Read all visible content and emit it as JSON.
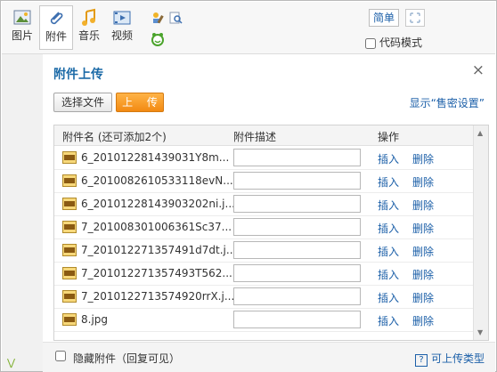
{
  "toolbar": {
    "buttons": [
      {
        "label": "图片",
        "icon": "image-icon"
      },
      {
        "label": "附件",
        "icon": "paperclip-icon"
      },
      {
        "label": "音乐",
        "icon": "music-icon"
      },
      {
        "label": "视频",
        "icon": "video-icon"
      }
    ],
    "simplified_label": "简单",
    "code_mode_label": "代码模式"
  },
  "panel": {
    "title": "附件上传",
    "close": "×",
    "choose_file": "选择文件",
    "upload": "上 传",
    "show_secret": "显示“售密设置”",
    "table_headers": {
      "name": "附件名 (还可添加2个)",
      "desc": "附件描述",
      "ops": "操作"
    },
    "rows": [
      {
        "file": "6_201012281439031Y8m...",
        "insert": "插入",
        "delete": "删除"
      },
      {
        "file": "6_2010082610533118evN...",
        "insert": "插入",
        "delete": "删除"
      },
      {
        "file": "6_20101228143903202ni.j...",
        "insert": "插入",
        "delete": "删除"
      },
      {
        "file": "7_201008301006361Sc37...",
        "insert": "插入",
        "delete": "删除"
      },
      {
        "file": "7_20101227135749​1d7dt.j...",
        "insert": "插入",
        "delete": "删除"
      },
      {
        "file": "7_201012271357493T562...",
        "insert": "插入",
        "delete": "删除"
      },
      {
        "file": "7_20101227135749​20rrX.j...",
        "insert": "插入",
        "delete": "删除"
      },
      {
        "file": "8.jpg",
        "insert": "插入",
        "delete": "删除"
      }
    ],
    "hide_attachments": "隐藏附件（回复可见）",
    "upload_types": "可上传类型"
  },
  "colors": {
    "accent": "#1b5fa8",
    "upload_btn": "#f28a12",
    "title": "#1b6aa7"
  }
}
